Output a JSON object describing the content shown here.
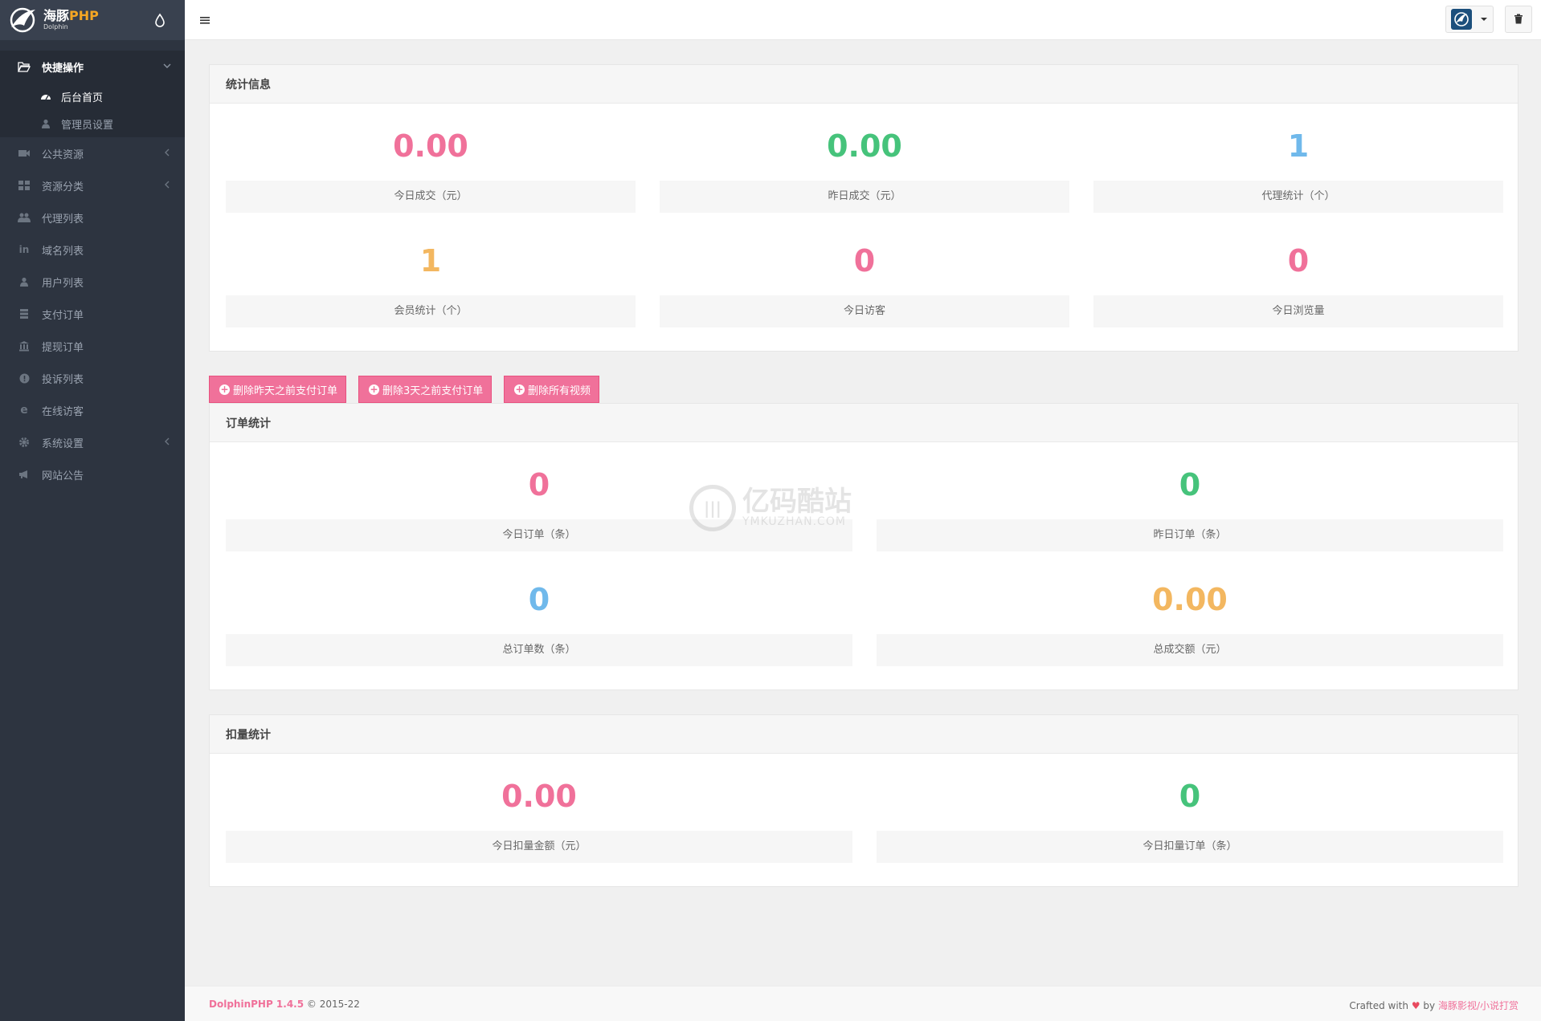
{
  "brand": {
    "cn": "海豚",
    "php": "PHP",
    "en": "Dolphin"
  },
  "sidebar": {
    "group": {
      "label": "快捷操作",
      "subitems": [
        {
          "label": "后台首页"
        },
        {
          "label": "管理员设置"
        }
      ]
    },
    "items": [
      {
        "label": "公共资源"
      },
      {
        "label": "资源分类"
      },
      {
        "label": "代理列表"
      },
      {
        "label": "域名列表"
      },
      {
        "label": "用户列表"
      },
      {
        "label": "支付订单"
      },
      {
        "label": "提现订单"
      },
      {
        "label": "投诉列表"
      },
      {
        "label": "在线访客"
      },
      {
        "label": "系统设置"
      },
      {
        "label": "网站公告"
      }
    ]
  },
  "stats": {
    "title": "统计信息",
    "cells": [
      {
        "value": "0.00",
        "label": "今日成交（元）"
      },
      {
        "value": "0.00",
        "label": "昨日成交（元）"
      },
      {
        "value": "1",
        "label": "代理统计（个）"
      },
      {
        "value": "1",
        "label": "会员统计（个）"
      },
      {
        "value": "0",
        "label": "今日访客"
      },
      {
        "value": "0",
        "label": "今日浏览量"
      }
    ]
  },
  "actions": {
    "delete_yesterday": "删除昨天之前支付订单",
    "delete_3days": "删除3天之前支付订单",
    "delete_videos": "删除所有视频"
  },
  "orders": {
    "title": "订单统计",
    "cells": [
      {
        "value": "0",
        "label": "今日订单（条）"
      },
      {
        "value": "0",
        "label": "昨日订单（条）"
      },
      {
        "value": "0",
        "label": "总订单数（条）"
      },
      {
        "value": "0.00",
        "label": "总成交额（元）"
      }
    ]
  },
  "deduct": {
    "title": "扣量统计",
    "cells": [
      {
        "value": "0.00",
        "label": "今日扣量金额（元）"
      },
      {
        "value": "0",
        "label": "今日扣量订单（条）"
      }
    ]
  },
  "watermark": {
    "cn": "亿码酷站",
    "en": "YMKUZHAN.COM"
  },
  "footer": {
    "version": "DolphinPHP 1.4.5",
    "copyright": "© 2015-22",
    "crafted": "Crafted with",
    "by": "by",
    "author": "海豚影视/小说打赏"
  },
  "colors": {
    "pink": "#f0719a",
    "green": "#46c37b",
    "blue": "#70b9eb",
    "orange": "#f3b760",
    "sidebar": "#2d3440"
  }
}
